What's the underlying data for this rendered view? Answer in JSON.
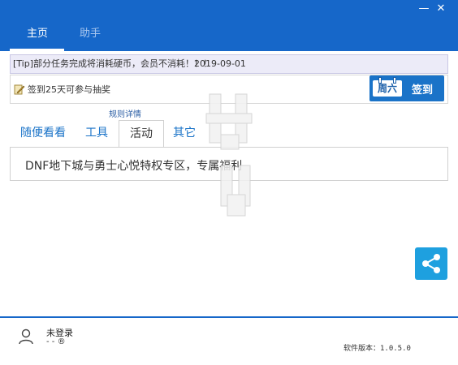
{
  "window": {
    "minimize_glyph": "—",
    "close_glyph": "✕"
  },
  "top_tabs": [
    "主页",
    "助手"
  ],
  "notice": {
    "text": "[Tip]部分任务完成将消耗硬币，会员不消耗！！！",
    "date": "2019-09-01"
  },
  "signin": {
    "label": "签到25天可参与抽奖",
    "day": "周六",
    "button": "签到"
  },
  "rules_link": "规则详情",
  "tabs": [
    "随便看看",
    "工具",
    "活动",
    "其它"
  ],
  "active_tab": 2,
  "content": {
    "line": "DNF地下城与勇士心悦特权专区，专属福利"
  },
  "footer": {
    "user_name": "未登录",
    "user_sub": "- - ®",
    "version": "软件版本：1.0.5.0"
  },
  "colors": {
    "brand": "#1667c9",
    "share": "#1ea0df",
    "notice_bg": "#ecebf8"
  },
  "icons": [
    "pen-icon",
    "share-icon",
    "user-icon"
  ]
}
